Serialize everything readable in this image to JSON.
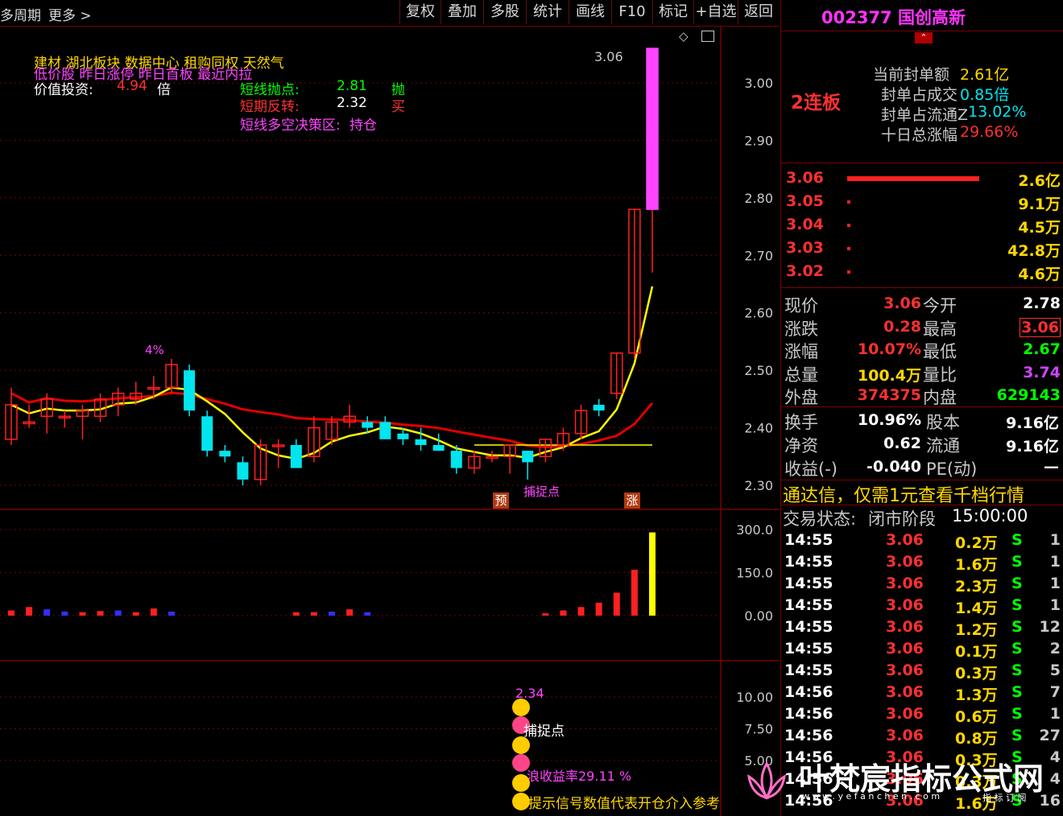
{
  "toolbar": {
    "period_label": "多周期",
    "more_label": "更多 >",
    "buttons": [
      "复权",
      "叠加",
      "多股",
      "统计",
      "画线",
      "F10",
      "标记",
      "+自选",
      "返回"
    ]
  },
  "annotations": {
    "concepts_line": "建材        湖北板块   数据中心 租购同权 天然气",
    "tags_line": "低价股 昨日涨停 昨日首板 最近内拉",
    "value_label": "价值投资:",
    "value_num": "4.94",
    "value_unit": "倍",
    "short_sell_label": "短线抛点:",
    "short_sell_value": "2.81",
    "short_sell_action": "抛",
    "short_reverse_label": "短期反转:",
    "short_reverse_value": "2.32",
    "short_reverse_action": "买",
    "zone_label": "短线多空决策区:",
    "zone_value": "持仓",
    "pct_label": "4%",
    "high_label": "3.06",
    "yu_label": "预",
    "zhang_label": "涨",
    "catch_label": "捕捉点",
    "lower_top_value": "2.34",
    "lower_catch": "捕捉点",
    "lower_yield": "浪收益率29.11 %",
    "lower_hint": "提示信号数值代表开仓介入参考"
  },
  "chart_data": {
    "type": "candlestick",
    "price_axis": [
      "3.00",
      "2.90",
      "2.80",
      "2.70",
      "2.60",
      "2.50",
      "2.40",
      "2.30"
    ],
    "volume_axis": [
      "300.0",
      "150.0",
      "0.00"
    ],
    "indicator_axis": [
      "10.00",
      "7.50",
      "5.00"
    ],
    "candles": [
      {
        "o": 2.38,
        "h": 2.47,
        "l": 2.37,
        "c": 2.44
      },
      {
        "o": 2.41,
        "h": 2.44,
        "l": 2.4,
        "c": 2.41
      },
      {
        "o": 2.42,
        "h": 2.46,
        "l": 2.39,
        "c": 2.45
      },
      {
        "o": 2.42,
        "h": 2.43,
        "l": 2.4,
        "c": 2.42
      },
      {
        "o": 2.42,
        "h": 2.44,
        "l": 2.38,
        "c": 2.43
      },
      {
        "o": 2.42,
        "h": 2.46,
        "l": 2.41,
        "c": 2.45
      },
      {
        "o": 2.44,
        "h": 2.47,
        "l": 2.42,
        "c": 2.46
      },
      {
        "o": 2.45,
        "h": 2.48,
        "l": 2.44,
        "c": 2.46
      },
      {
        "o": 2.47,
        "h": 2.49,
        "l": 2.45,
        "c": 2.47
      },
      {
        "o": 2.47,
        "h": 2.52,
        "l": 2.46,
        "c": 2.51
      },
      {
        "o": 2.5,
        "h": 2.51,
        "l": 2.42,
        "c": 2.43
      },
      {
        "o": 2.42,
        "h": 2.43,
        "l": 2.35,
        "c": 2.36
      },
      {
        "o": 2.36,
        "h": 2.37,
        "l": 2.34,
        "c": 2.35
      },
      {
        "o": 2.34,
        "h": 2.35,
        "l": 2.3,
        "c": 2.31
      },
      {
        "o": 2.31,
        "h": 2.38,
        "l": 2.3,
        "c": 2.37
      },
      {
        "o": 2.37,
        "h": 2.38,
        "l": 2.33,
        "c": 2.37
      },
      {
        "o": 2.37,
        "h": 2.38,
        "l": 2.33,
        "c": 2.33
      },
      {
        "o": 2.35,
        "h": 2.42,
        "l": 2.34,
        "c": 2.4
      },
      {
        "o": 2.38,
        "h": 2.42,
        "l": 2.37,
        "c": 2.41
      },
      {
        "o": 2.41,
        "h": 2.44,
        "l": 2.4,
        "c": 2.42
      },
      {
        "o": 2.41,
        "h": 2.42,
        "l": 2.39,
        "c": 2.4
      },
      {
        "o": 2.41,
        "h": 2.42,
        "l": 2.38,
        "c": 2.38
      },
      {
        "o": 2.39,
        "h": 2.4,
        "l": 2.37,
        "c": 2.38
      },
      {
        "o": 2.38,
        "h": 2.4,
        "l": 2.36,
        "c": 2.37
      },
      {
        "o": 2.37,
        "h": 2.39,
        "l": 2.36,
        "c": 2.36
      },
      {
        "o": 2.36,
        "h": 2.37,
        "l": 2.32,
        "c": 2.33
      },
      {
        "o": 2.33,
        "h": 2.36,
        "l": 2.32,
        "c": 2.35
      },
      {
        "o": 2.35,
        "h": 2.36,
        "l": 2.34,
        "c": 2.35
      },
      {
        "o": 2.35,
        "h": 2.37,
        "l": 2.32,
        "c": 2.37
      },
      {
        "o": 2.36,
        "h": 2.36,
        "l": 2.31,
        "c": 2.34
      },
      {
        "o": 2.35,
        "h": 2.38,
        "l": 2.34,
        "c": 2.38
      },
      {
        "o": 2.37,
        "h": 2.4,
        "l": 2.36,
        "c": 2.39
      },
      {
        "o": 2.39,
        "h": 2.44,
        "l": 2.38,
        "c": 2.43
      },
      {
        "o": 2.44,
        "h": 2.45,
        "l": 2.42,
        "c": 2.43
      },
      {
        "o": 2.46,
        "h": 2.53,
        "l": 2.45,
        "c": 2.53
      },
      {
        "o": 2.53,
        "h": 2.78,
        "l": 2.52,
        "c": 2.78
      },
      {
        "o": 2.78,
        "h": 3.06,
        "l": 2.67,
        "c": 3.06
      }
    ],
    "volumes": [
      {
        "v": 18,
        "up": true
      },
      {
        "v": 30,
        "up": true
      },
      {
        "v": 22,
        "up": false
      },
      {
        "v": 14,
        "up": false
      },
      {
        "v": 12,
        "up": true
      },
      {
        "v": 16,
        "up": true
      },
      {
        "v": 18,
        "up": false
      },
      {
        "v": 12,
        "up": true
      },
      {
        "v": 25,
        "up": true
      },
      {
        "v": 14,
        "up": false
      },
      {
        "v": 0,
        "up": true
      },
      {
        "v": 0,
        "up": true
      },
      {
        "v": 0,
        "up": true
      },
      {
        "v": 0,
        "up": true
      },
      {
        "v": 0,
        "up": true
      },
      {
        "v": 0,
        "up": true
      },
      {
        "v": 12,
        "up": true
      },
      {
        "v": 12,
        "up": true
      },
      {
        "v": 14,
        "up": false
      },
      {
        "v": 22,
        "up": true
      },
      {
        "v": 12,
        "up": false
      },
      {
        "v": 0,
        "up": true
      },
      {
        "v": 0,
        "up": true
      },
      {
        "v": 0,
        "up": true
      },
      {
        "v": 0,
        "up": true
      },
      {
        "v": 0,
        "up": true
      },
      {
        "v": 0,
        "up": true
      },
      {
        "v": 0,
        "up": true
      },
      {
        "v": 0,
        "up": true
      },
      {
        "v": 0,
        "up": true
      },
      {
        "v": 8,
        "up": true
      },
      {
        "v": 18,
        "up": true
      },
      {
        "v": 30,
        "up": true
      },
      {
        "v": 45,
        "up": true
      },
      {
        "v": 80,
        "up": true
      },
      {
        "v": 160,
        "up": true
      },
      {
        "v": 290,
        "up": true,
        "highlight": true
      }
    ]
  },
  "right_panel": {
    "code": "002377",
    "name": "国创高新",
    "board_tag": "2连板",
    "seal_amount_label": "当前封单额",
    "seal_amount": "2.61亿",
    "seal_turnover_label": "封单占成交",
    "seal_turnover": "0.85倍",
    "seal_float_label": "封单占流通Z",
    "seal_float": "13.02%",
    "ten_day_label": "十日总涨幅",
    "ten_day": "29.66%",
    "bids": [
      {
        "price": "3.06",
        "vol": "2.6亿",
        "bar": "big"
      },
      {
        "price": "3.05",
        "vol": "9.1万",
        "bar": "dot"
      },
      {
        "price": "3.04",
        "vol": "4.5万",
        "bar": "dot"
      },
      {
        "price": "3.03",
        "vol": "42.8万",
        "bar": "dot"
      },
      {
        "price": "3.02",
        "vol": "4.6万",
        "bar": "dot"
      }
    ],
    "quote_left": [
      {
        "label": "现价",
        "value": "3.06",
        "color": "#ff3030"
      },
      {
        "label": "涨跌",
        "value": "0.28",
        "color": "#ff3030"
      },
      {
        "label": "涨幅",
        "value": "10.07%",
        "color": "#ff3030"
      },
      {
        "label": "总量",
        "value": "100.4万",
        "color": "#ffd700"
      },
      {
        "label": "外盘",
        "value": "374375",
        "color": "#ff3030"
      }
    ],
    "quote_right": [
      {
        "label": "今开",
        "value": "2.78",
        "color": "#ffffff"
      },
      {
        "label": "最高",
        "value": "3.06",
        "color": "#ff3030",
        "boxed": true
      },
      {
        "label": "最低",
        "value": "2.67",
        "color": "#00ff00"
      },
      {
        "label": "量比",
        "value": "3.74",
        "color": "#cc44ff"
      },
      {
        "label": "内盘",
        "value": "629143",
        "color": "#00ff00"
      }
    ],
    "fund_left": [
      {
        "label": "换手",
        "value": "10.96%"
      },
      {
        "label": "净资",
        "value": "0.62"
      },
      {
        "label": "收益(-)",
        "value": "-0.040"
      }
    ],
    "fund_right": [
      {
        "label": "股本",
        "value": "9.16亿"
      },
      {
        "label": "流通",
        "value": "9.16亿"
      },
      {
        "label": "PE(动)",
        "value": "—"
      }
    ],
    "promo": "通达信，仅需1元查看千档行情",
    "trade_state_label": "交易状态:",
    "trade_state": "闭市阶段",
    "trade_time": "15:00:00",
    "ticks": [
      {
        "t": "14:55",
        "p": "3.06",
        "v": "0.2万",
        "s": "S",
        "n": "1"
      },
      {
        "t": "14:55",
        "p": "3.06",
        "v": "1.6万",
        "s": "S",
        "n": "1"
      },
      {
        "t": "14:55",
        "p": "3.06",
        "v": "2.3万",
        "s": "S",
        "n": "1"
      },
      {
        "t": "14:55",
        "p": "3.06",
        "v": "1.4万",
        "s": "S",
        "n": "1"
      },
      {
        "t": "14:55",
        "p": "3.06",
        "v": "1.2万",
        "s": "S",
        "n": "12"
      },
      {
        "t": "14:55",
        "p": "3.06",
        "v": "0.1万",
        "s": "S",
        "n": "2"
      },
      {
        "t": "14:55",
        "p": "3.06",
        "v": "0.3万",
        "s": "S",
        "n": "5"
      },
      {
        "t": "14:56",
        "p": "3.06",
        "v": "1.3万",
        "s": "S",
        "n": "7"
      },
      {
        "t": "14:56",
        "p": "3.06",
        "v": "0.6万",
        "s": "S",
        "n": "1"
      },
      {
        "t": "14:56",
        "p": "3.06",
        "v": "0.8万",
        "s": "S",
        "n": "27"
      },
      {
        "t": "14:56",
        "p": "3.06",
        "v": "0.3万",
        "s": "S",
        "n": "4"
      },
      {
        "t": "14:56",
        "p": "3.06",
        "v": "0.3万",
        "s": "S",
        "n": "4"
      },
      {
        "t": "14:56",
        "p": "3.06",
        "v": "1.6万",
        "s": "S",
        "n": "16"
      }
    ]
  },
  "watermark": {
    "text": "叶梵宸指标公式网",
    "url": "w w w . y e f a n c h e n . c o m",
    "tag": "指 标 订 阅"
  },
  "colors": {
    "up": "#ff2020",
    "down": "#00e5ee",
    "ma_red": "#e00000",
    "ma_yellow": "#ffff00",
    "ma_blue": "#3030ff",
    "grid": "#7a0000"
  }
}
